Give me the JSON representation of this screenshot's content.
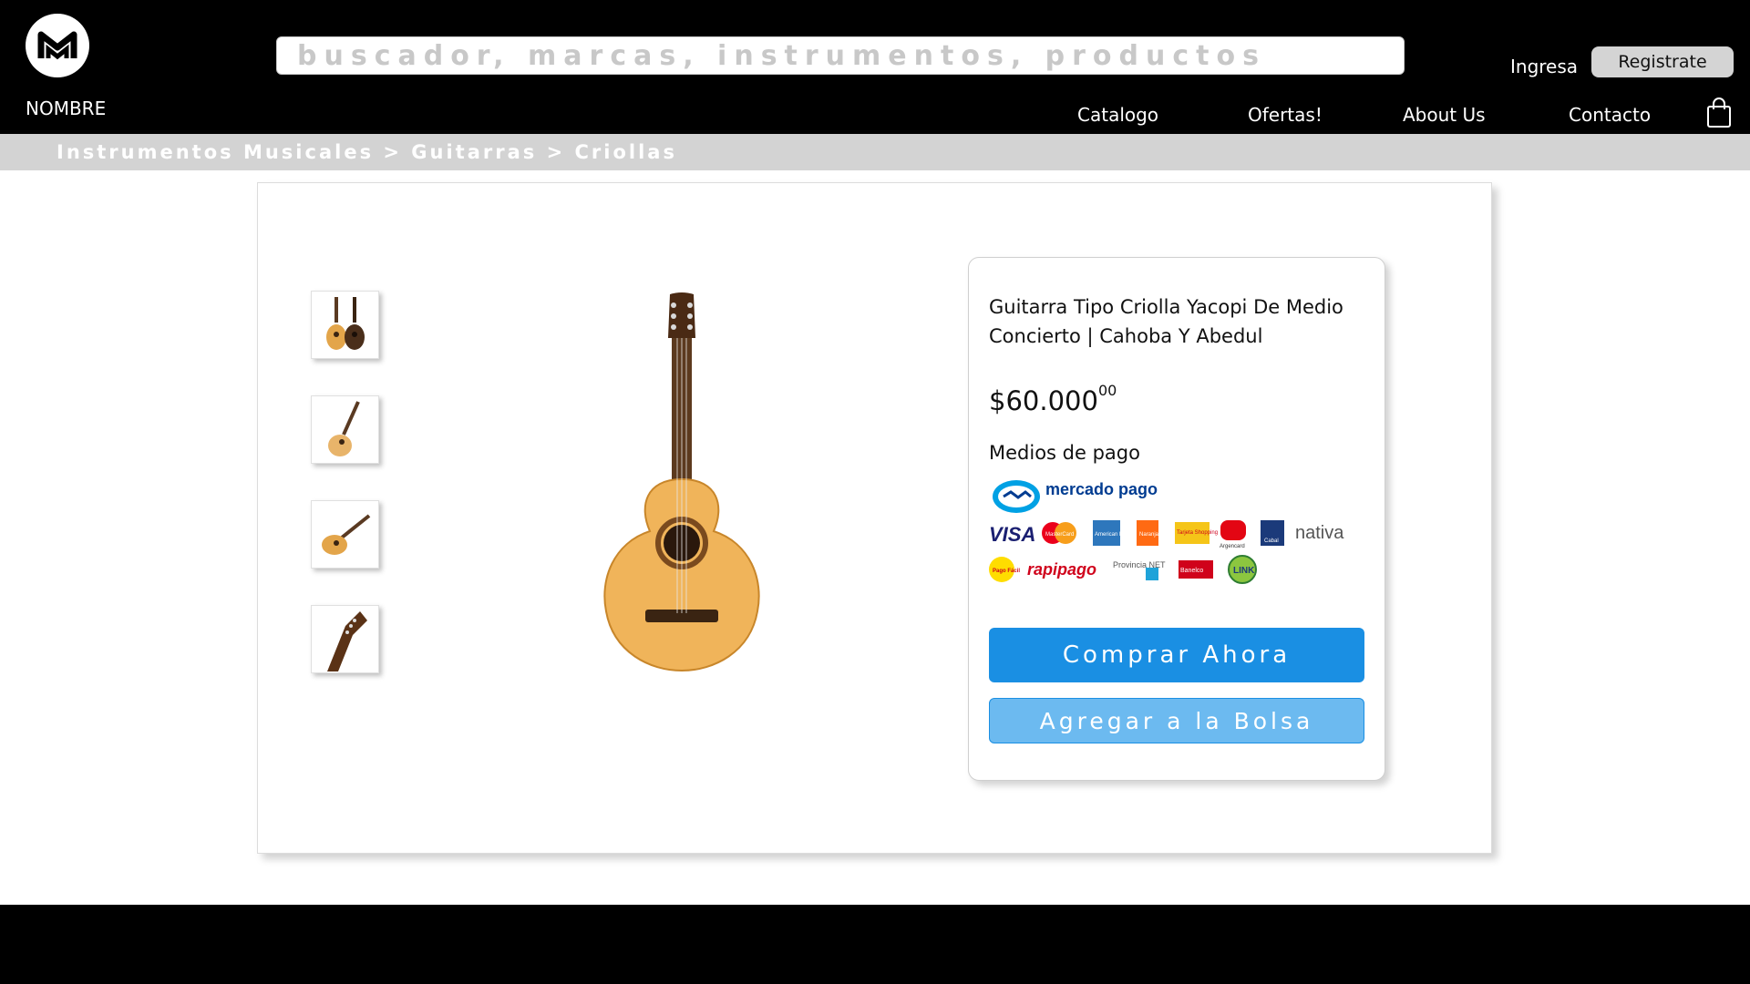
{
  "header": {
    "brand_name": "NOMBRE",
    "search_placeholder": "buscador, marcas, instrumentos, productos",
    "login_label": "Ingresa",
    "register_label": "Registrate",
    "nav": [
      "Catalogo",
      "Ofertas!",
      "About Us",
      "Contacto"
    ],
    "cart_icon": "shopping-bag-icon",
    "logo_icon": "m-logo-icon"
  },
  "breadcrumb": "Instrumentos Musicales > Guitarras > Criollas",
  "product": {
    "title": "Guitarra Tipo Criolla Yacopi De Medio Concierto | Cahoba Y Abedul",
    "price_main": "$60.000",
    "price_cents": "00",
    "payment_label": "Medios de pago",
    "payment_methods": [
      "mercado pago",
      "VISA",
      "MasterCard",
      "American Express",
      "Naranja",
      "Tarjeta Shopping",
      "Argencard",
      "Cabal",
      "nativa",
      "Pago Fácil",
      "rapipago",
      "Provincia NET",
      "Banelco",
      "LINK"
    ],
    "buy_label": "Comprar Ahora",
    "bag_label": "Agregar a la Bolsa",
    "thumbnail_count": 4
  },
  "colors": {
    "header_bg": "#000000",
    "breadcrumb_bg": "#d3d3d3",
    "buy_button": "#1a8fe3",
    "bag_button": "#6cbaf0"
  }
}
